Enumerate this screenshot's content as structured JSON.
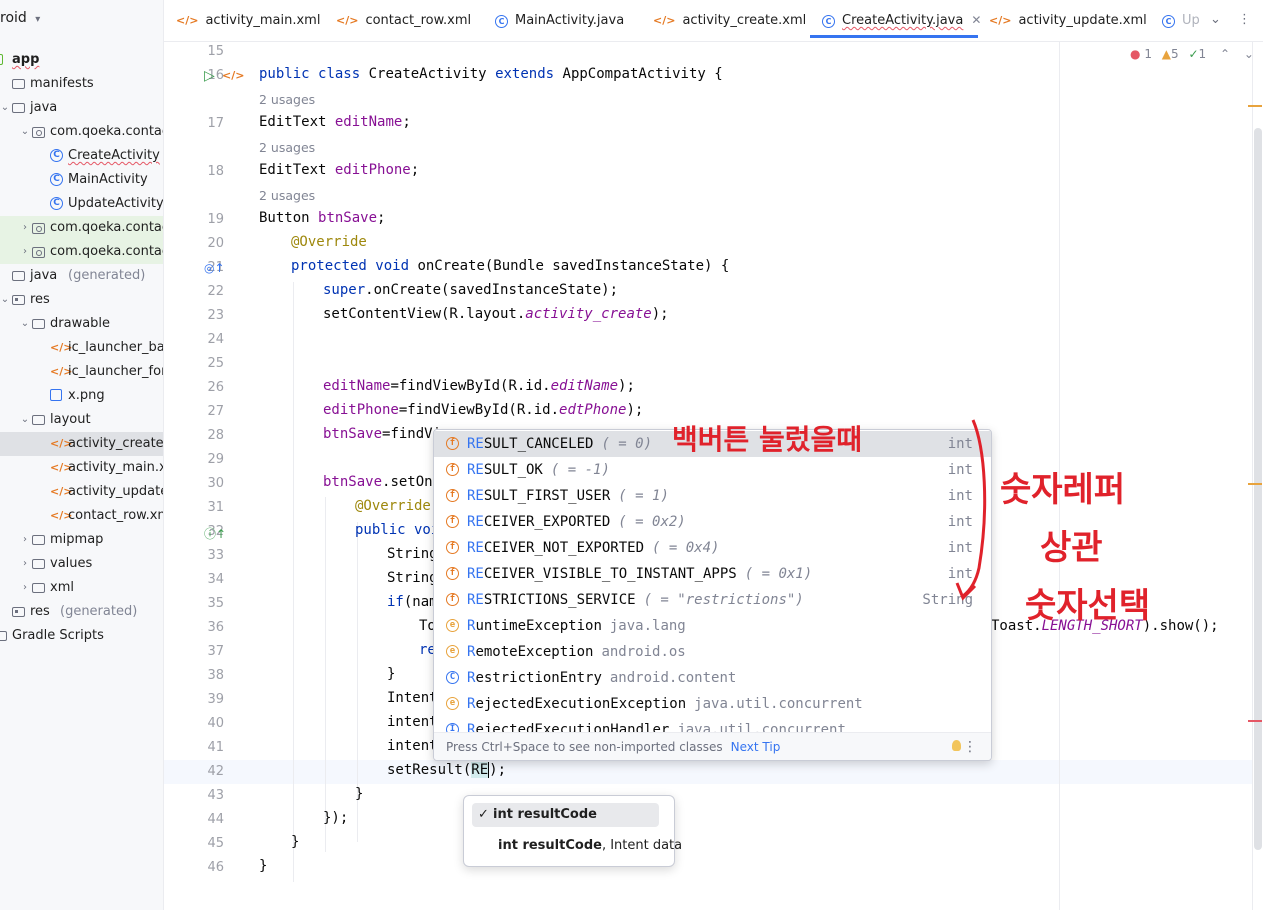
{
  "project": {
    "header": "roid",
    "items": [
      {
        "label": "app",
        "icon": "module-icon",
        "indent": 0
      },
      {
        "label": "manifests",
        "icon": "folder-icon",
        "indent": 1
      },
      {
        "label": "java",
        "icon": "folder-icon",
        "indent": 1
      },
      {
        "label": "com.qoeka.contacta",
        "icon": "package-icon",
        "indent": 2
      },
      {
        "label": "CreateActivity",
        "icon": "class-icon",
        "indent": 3
      },
      {
        "label": "MainActivity",
        "icon": "class-icon",
        "indent": 3
      },
      {
        "label": "UpdateActivity",
        "icon": "class-icon",
        "indent": 3
      },
      {
        "label": "com.qoeka.contacta",
        "icon": "package-icon",
        "indent": 2
      },
      {
        "label": "com.qoeka.contacta",
        "icon": "package-icon",
        "indent": 2
      },
      {
        "label": "java",
        "suffix": "(generated)",
        "icon": "folder-icon",
        "indent": 1
      },
      {
        "label": "res",
        "icon": "res-folder-icon",
        "indent": 1
      },
      {
        "label": "drawable",
        "icon": "folder-icon",
        "indent": 2
      },
      {
        "label": "ic_launcher_bacl",
        "icon": "xml-icon",
        "indent": 3
      },
      {
        "label": "ic_launcher_fore",
        "icon": "xml-icon",
        "indent": 3
      },
      {
        "label": "x.png",
        "icon": "image-icon",
        "indent": 3
      },
      {
        "label": "layout",
        "icon": "folder-icon",
        "indent": 2
      },
      {
        "label": "activity_create.xm",
        "icon": "xml-icon",
        "indent": 3
      },
      {
        "label": "activity_main.xml",
        "icon": "xml-icon",
        "indent": 3
      },
      {
        "label": "activity_update.x",
        "icon": "xml-icon",
        "indent": 3
      },
      {
        "label": "contact_row.xml",
        "icon": "xml-icon",
        "indent": 3
      },
      {
        "label": "mipmap",
        "icon": "folder-icon",
        "indent": 2
      },
      {
        "label": "values",
        "icon": "folder-icon",
        "indent": 2
      },
      {
        "label": "xml",
        "icon": "folder-icon",
        "indent": 2
      },
      {
        "label": "res",
        "suffix": "(generated)",
        "icon": "res-folder-icon",
        "indent": 1
      },
      {
        "label": "Gradle Scripts",
        "icon": "gradle-icon",
        "indent": 0
      }
    ]
  },
  "tabs": [
    {
      "label": "activity_main.xml",
      "icon": "xml-icon"
    },
    {
      "label": "contact_row.xml",
      "icon": "xml-icon"
    },
    {
      "label": "MainActivity.java",
      "icon": "class-icon"
    },
    {
      "label": "activity_create.xml",
      "icon": "xml-icon"
    },
    {
      "label": "CreateActivity.java",
      "icon": "class-icon",
      "active": true
    },
    {
      "label": "activity_update.xml",
      "icon": "xml-icon"
    },
    {
      "label": "Up",
      "icon": "class-icon"
    }
  ],
  "inspections": {
    "errors": "1",
    "warnings": "5",
    "typos": "1"
  },
  "code": {
    "line_numbers": [
      "15",
      "16",
      "17",
      "18",
      "19",
      "20",
      "21",
      "22",
      "23",
      "24",
      "25",
      "26",
      "27",
      "28",
      "29",
      "30",
      "31",
      "32",
      "33",
      "34",
      "35",
      "36",
      "37",
      "38",
      "39",
      "40",
      "41",
      "42",
      "43",
      "44",
      "45",
      "46"
    ],
    "usages": "2 usages",
    "l16": {
      "kw1": "public",
      "kw2": "class",
      "name": "CreateActivity",
      "kw3": "extends",
      "parent": "AppCompatActivity {"
    },
    "l17": {
      "type": "EditText",
      "field": "editName",
      "end": ";"
    },
    "l18": {
      "type": "EditText",
      "field": "editPhone",
      "end": ";"
    },
    "l19": {
      "type": "Button",
      "field": "btnSave",
      "end": ";"
    },
    "l20": "@Override",
    "l21": {
      "kw1": "protected",
      "kw2": "void",
      "rest": " onCreate(Bundle savedInstanceState) {"
    },
    "l22": {
      "kw": "super",
      "rest": ".onCreate(savedInstanceState);"
    },
    "l23": {
      "pre": "setContentView(R.layout.",
      "ital": "activity_create",
      "post": ");"
    },
    "l26": {
      "field": "editName",
      "pre": "=findViewById(R.id.",
      "ital": "editName",
      "post": ");"
    },
    "l27": {
      "field": "editPhone",
      "pre": "=findViewById(R.id.",
      "ital": "edtPhone",
      "post": ");"
    },
    "l28": {
      "field": "btnSave",
      "pre": "=findVi"
    },
    "l30": {
      "field": "btnSave",
      "pre": ".setOnC"
    },
    "l31": "@Override",
    "l32": {
      "kw": "public",
      "rest": " voi"
    },
    "l33": "String",
    "l34": "String",
    "l35": {
      "kw": "if",
      "rest": "(nam"
    },
    "l36_left": "To",
    "l36_right": {
      "pre": "Toast.",
      "ital": "LENGTH_SHORT",
      "post": ").show();"
    },
    "l37": "re",
    "l38": "}",
    "l39": "Intent",
    "l40": "intent",
    "l41": "intent",
    "l42": {
      "pre": "setResult(",
      "typed": "RE",
      "post": ");"
    },
    "l43": "}",
    "l44": "});",
    "l45": "}",
    "l46": "}"
  },
  "completion": {
    "items": [
      {
        "match": "RE",
        "rest": "SULT_CANCELED",
        "hint": "( = 0)",
        "type": "int",
        "icon": "field-icon",
        "selected": true
      },
      {
        "match": "RE",
        "rest": "SULT_OK",
        "hint": "( = -1)",
        "type": "int",
        "icon": "field-icon"
      },
      {
        "match": "RE",
        "rest": "SULT_FIRST_USER",
        "hint": "( = 1)",
        "type": "int",
        "icon": "field-icon"
      },
      {
        "match": "RE",
        "rest": "CEIVER_EXPORTED",
        "hint": "( = 0x2)",
        "type": "int",
        "icon": "field-icon"
      },
      {
        "match": "RE",
        "rest": "CEIVER_NOT_EXPORTED",
        "hint": "( = 0x4)",
        "type": "int",
        "icon": "field-icon"
      },
      {
        "match": "RE",
        "rest": "CEIVER_VISIBLE_TO_INSTANT_APPS",
        "hint": "( = 0x1)",
        "type": "int",
        "icon": "field-icon"
      },
      {
        "match": "RE",
        "rest": "STRICTIONS_SERVICE",
        "hint": "( = \"restrictions\")",
        "type": "String",
        "icon": "field-icon"
      },
      {
        "pre": "R",
        "match": "",
        "rest": "untimeException",
        "hint": "java.lang",
        "type": "",
        "icon": "exception-icon"
      },
      {
        "pre": "R",
        "match": "",
        "rest": "emoteException",
        "hint": "android.os",
        "type": "",
        "icon": "exception-icon"
      },
      {
        "pre": "R",
        "match": "",
        "rest": "estrictionEntry",
        "hint": "android.content",
        "type": "",
        "icon": "class-icon"
      },
      {
        "pre": "R",
        "match": "",
        "rest": "ejectedExecutionException",
        "hint": "java.util.concurrent",
        "type": "",
        "icon": "exception-icon"
      },
      {
        "pre": "R",
        "match": "",
        "rest": "ejectedExecutionHandler",
        "hint": "java.util.concurrent",
        "type": "",
        "icon": "interface-icon"
      }
    ],
    "footer": "Press Ctrl+Space to see non-imported classes",
    "next_tip": "Next Tip"
  },
  "param_info": {
    "options": [
      {
        "bold": "int resultCode",
        "rest": "",
        "selected": true
      },
      {
        "bold": "int resultCode",
        "rest": ", Intent data",
        "selected": false
      }
    ]
  },
  "handwriting": {
    "top": "백버튼 눌렀을때",
    "right1": "숫자레퍼",
    "right2": "상관",
    "right3": "숫자선택"
  },
  "colors": {
    "accent": "#3574f0",
    "keyword": "#0033b3",
    "field": "#871094",
    "annotation": "#9e880d",
    "handwriting": "#e0222b"
  }
}
